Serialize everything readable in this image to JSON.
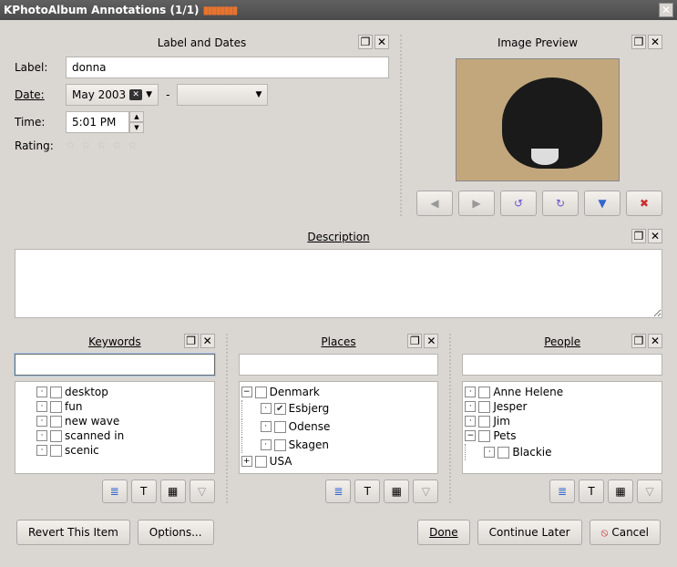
{
  "window": {
    "title": "KPhotoAlbum Annotations (1/1)"
  },
  "panels": {
    "labelDates": "Label and Dates",
    "preview": "Image Preview",
    "description": "Description",
    "keywords": "Keywords",
    "places": "Places",
    "people": "People"
  },
  "labels": {
    "label": "Label:",
    "date": "Date:",
    "time": "Time:",
    "rating": "Rating:"
  },
  "values": {
    "label": "donna",
    "date_from": "May 2003",
    "date_to": "",
    "time": "5:01 PM",
    "description": "",
    "dash": "-"
  },
  "keywords": {
    "filter": "",
    "items": [
      "desktop",
      "fun",
      "new wave",
      "scanned in",
      "scenic"
    ]
  },
  "places": {
    "filter": "",
    "tree": [
      {
        "label": "Denmark",
        "children": [
          {
            "label": "Esbjerg",
            "checked": true
          },
          {
            "label": "Odense"
          },
          {
            "label": "Skagen"
          }
        ]
      },
      {
        "label": "USA",
        "children": []
      }
    ]
  },
  "people": {
    "filter": "",
    "tree": [
      {
        "label": "Anne Helene"
      },
      {
        "label": "Jesper"
      },
      {
        "label": "Jim"
      },
      {
        "label": "Pets",
        "children": [
          {
            "label": "Blackie"
          }
        ]
      }
    ]
  },
  "buttons": {
    "revert": "Revert This Item",
    "options": "Options...",
    "done": "Done",
    "continue": "Continue Later",
    "cancel": "Cancel"
  },
  "icons": {
    "detach": "❐",
    "close": "✕",
    "prev": "◀",
    "next": "▶",
    "rotL": "↺",
    "rotR": "↻",
    "fullscreen": "▼",
    "delete": "✖",
    "sortTree": "≣",
    "sortAlpha": "T",
    "sortDate": "▦",
    "filter": "▽",
    "star": "☆",
    "minus": "−",
    "plus": "+",
    "dot": "·"
  }
}
